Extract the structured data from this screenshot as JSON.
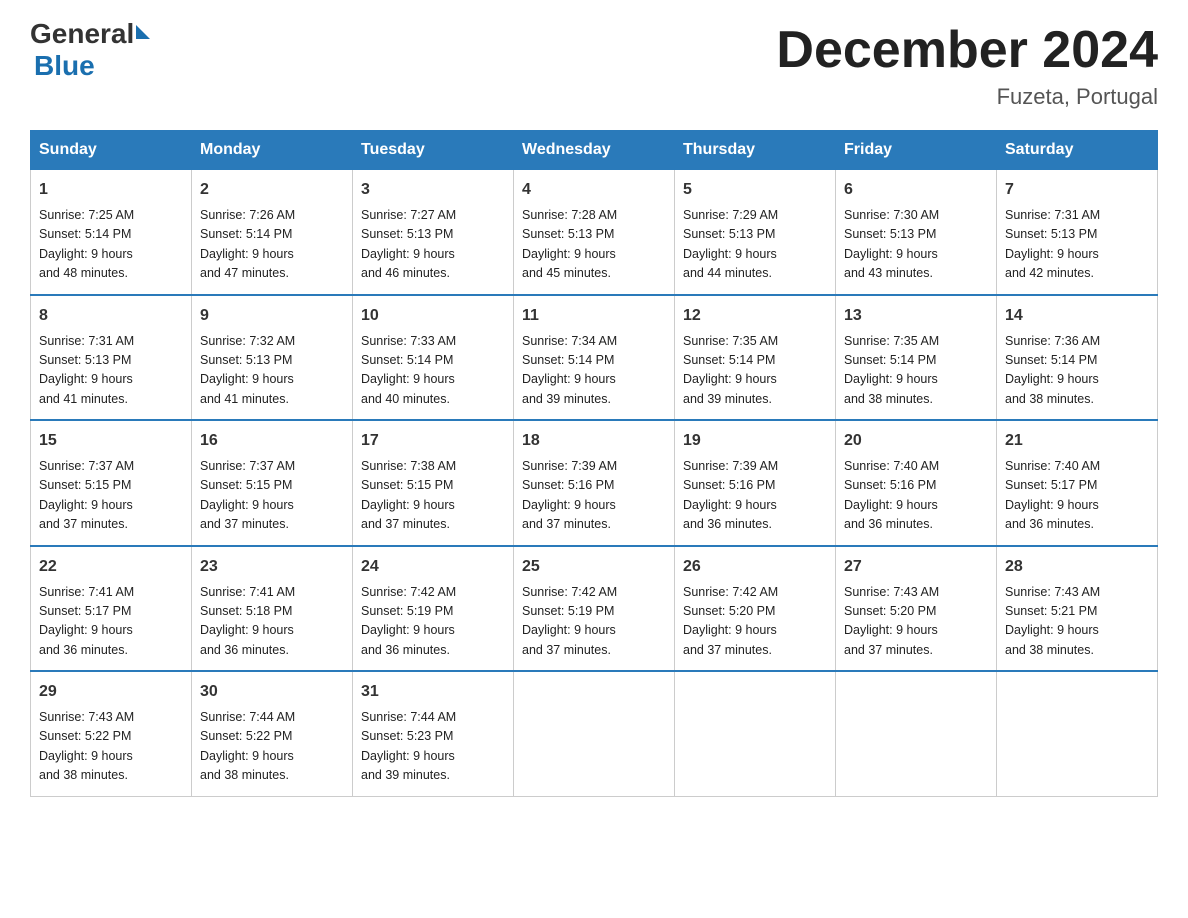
{
  "header": {
    "logo": {
      "general": "General",
      "blue": "Blue"
    },
    "title": "December 2024",
    "location": "Fuzeta, Portugal"
  },
  "days_of_week": [
    "Sunday",
    "Monday",
    "Tuesday",
    "Wednesday",
    "Thursday",
    "Friday",
    "Saturday"
  ],
  "weeks": [
    [
      {
        "day": "1",
        "sunrise": "7:25 AM",
        "sunset": "5:14 PM",
        "daylight": "9 hours and 48 minutes."
      },
      {
        "day": "2",
        "sunrise": "7:26 AM",
        "sunset": "5:14 PM",
        "daylight": "9 hours and 47 minutes."
      },
      {
        "day": "3",
        "sunrise": "7:27 AM",
        "sunset": "5:13 PM",
        "daylight": "9 hours and 46 minutes."
      },
      {
        "day": "4",
        "sunrise": "7:28 AM",
        "sunset": "5:13 PM",
        "daylight": "9 hours and 45 minutes."
      },
      {
        "day": "5",
        "sunrise": "7:29 AM",
        "sunset": "5:13 PM",
        "daylight": "9 hours and 44 minutes."
      },
      {
        "day": "6",
        "sunrise": "7:30 AM",
        "sunset": "5:13 PM",
        "daylight": "9 hours and 43 minutes."
      },
      {
        "day": "7",
        "sunrise": "7:31 AM",
        "sunset": "5:13 PM",
        "daylight": "9 hours and 42 minutes."
      }
    ],
    [
      {
        "day": "8",
        "sunrise": "7:31 AM",
        "sunset": "5:13 PM",
        "daylight": "9 hours and 41 minutes."
      },
      {
        "day": "9",
        "sunrise": "7:32 AM",
        "sunset": "5:13 PM",
        "daylight": "9 hours and 41 minutes."
      },
      {
        "day": "10",
        "sunrise": "7:33 AM",
        "sunset": "5:14 PM",
        "daylight": "9 hours and 40 minutes."
      },
      {
        "day": "11",
        "sunrise": "7:34 AM",
        "sunset": "5:14 PM",
        "daylight": "9 hours and 39 minutes."
      },
      {
        "day": "12",
        "sunrise": "7:35 AM",
        "sunset": "5:14 PM",
        "daylight": "9 hours and 39 minutes."
      },
      {
        "day": "13",
        "sunrise": "7:35 AM",
        "sunset": "5:14 PM",
        "daylight": "9 hours and 38 minutes."
      },
      {
        "day": "14",
        "sunrise": "7:36 AM",
        "sunset": "5:14 PM",
        "daylight": "9 hours and 38 minutes."
      }
    ],
    [
      {
        "day": "15",
        "sunrise": "7:37 AM",
        "sunset": "5:15 PM",
        "daylight": "9 hours and 37 minutes."
      },
      {
        "day": "16",
        "sunrise": "7:37 AM",
        "sunset": "5:15 PM",
        "daylight": "9 hours and 37 minutes."
      },
      {
        "day": "17",
        "sunrise": "7:38 AM",
        "sunset": "5:15 PM",
        "daylight": "9 hours and 37 minutes."
      },
      {
        "day": "18",
        "sunrise": "7:39 AM",
        "sunset": "5:16 PM",
        "daylight": "9 hours and 37 minutes."
      },
      {
        "day": "19",
        "sunrise": "7:39 AM",
        "sunset": "5:16 PM",
        "daylight": "9 hours and 36 minutes."
      },
      {
        "day": "20",
        "sunrise": "7:40 AM",
        "sunset": "5:16 PM",
        "daylight": "9 hours and 36 minutes."
      },
      {
        "day": "21",
        "sunrise": "7:40 AM",
        "sunset": "5:17 PM",
        "daylight": "9 hours and 36 minutes."
      }
    ],
    [
      {
        "day": "22",
        "sunrise": "7:41 AM",
        "sunset": "5:17 PM",
        "daylight": "9 hours and 36 minutes."
      },
      {
        "day": "23",
        "sunrise": "7:41 AM",
        "sunset": "5:18 PM",
        "daylight": "9 hours and 36 minutes."
      },
      {
        "day": "24",
        "sunrise": "7:42 AM",
        "sunset": "5:19 PM",
        "daylight": "9 hours and 36 minutes."
      },
      {
        "day": "25",
        "sunrise": "7:42 AM",
        "sunset": "5:19 PM",
        "daylight": "9 hours and 37 minutes."
      },
      {
        "day": "26",
        "sunrise": "7:42 AM",
        "sunset": "5:20 PM",
        "daylight": "9 hours and 37 minutes."
      },
      {
        "day": "27",
        "sunrise": "7:43 AM",
        "sunset": "5:20 PM",
        "daylight": "9 hours and 37 minutes."
      },
      {
        "day": "28",
        "sunrise": "7:43 AM",
        "sunset": "5:21 PM",
        "daylight": "9 hours and 38 minutes."
      }
    ],
    [
      {
        "day": "29",
        "sunrise": "7:43 AM",
        "sunset": "5:22 PM",
        "daylight": "9 hours and 38 minutes."
      },
      {
        "day": "30",
        "sunrise": "7:44 AM",
        "sunset": "5:22 PM",
        "daylight": "9 hours and 38 minutes."
      },
      {
        "day": "31",
        "sunrise": "7:44 AM",
        "sunset": "5:23 PM",
        "daylight": "9 hours and 39 minutes."
      },
      null,
      null,
      null,
      null
    ]
  ],
  "labels": {
    "sunrise_prefix": "Sunrise: ",
    "sunset_prefix": "Sunset: ",
    "daylight_prefix": "Daylight: "
  }
}
